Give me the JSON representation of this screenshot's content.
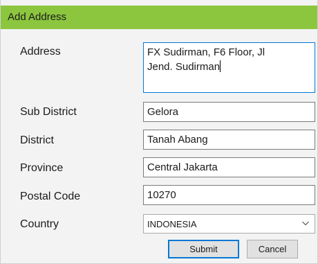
{
  "window": {
    "title": "Add Address"
  },
  "form": {
    "address": {
      "label": "Address",
      "line1": "FX Sudirman, F6 Floor, Jl",
      "line2": "Jend. Sudirman"
    },
    "sub_district": {
      "label": "Sub District",
      "value": "Gelora"
    },
    "district": {
      "label": "District",
      "value": "Tanah Abang"
    },
    "province": {
      "label": "Province",
      "value": "Central Jakarta"
    },
    "postal_code": {
      "label": "Postal Code",
      "value": "10270"
    },
    "country": {
      "label": "Country",
      "value": "INDONESIA"
    }
  },
  "buttons": {
    "submit": "Submit",
    "cancel": "Cancel"
  },
  "colors": {
    "titlebar": "#8cc63f",
    "focus_border": "#0078d7"
  },
  "icons": {
    "country_dropdown": "chevron-down-icon"
  }
}
